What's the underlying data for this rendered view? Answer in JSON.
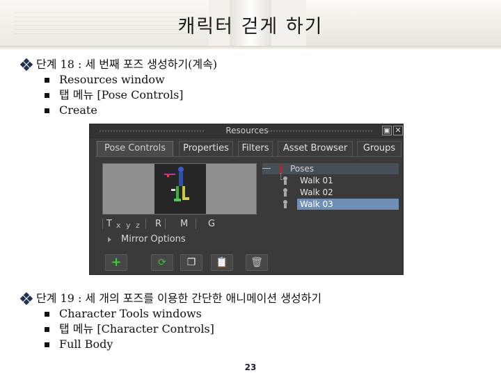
{
  "slide": {
    "title": "캐릭터 걷게 하기",
    "page_number": "23"
  },
  "step18": {
    "label": "단계 18 : 세 번째 포즈 생성하기(계속)",
    "items": [
      "Resources window",
      "탭 메뉴 [Pose Controls]",
      "Create"
    ]
  },
  "step19": {
    "label": "단계 19 : 세 개의 포즈를 이용한 간단한 애니메이션 생성하기",
    "items": [
      "Character Tools windows",
      "탭 메뉴 [Character Controls]",
      "Full Body"
    ]
  },
  "resources_panel": {
    "title": "Resources",
    "tabs": [
      "Pose Controls",
      "Properties",
      "Filters",
      "Asset Browser",
      "Groups"
    ],
    "active_tab": "Pose Controls",
    "axis_labels": {
      "t": "T",
      "x": "x",
      "y": "y",
      "z": "z",
      "r": "R",
      "m": "M",
      "g": "G"
    },
    "mirror_options": "Mirror Options",
    "tree": {
      "root": "Poses",
      "children": [
        "Walk 01",
        "Walk 02",
        "Walk 03"
      ],
      "selected": "Walk 03"
    },
    "toolbar_icons": [
      "add-pose-icon",
      "refresh-icon",
      "copy-pose-icon",
      "paste-pose-icon",
      "delete-pose-icon"
    ]
  }
}
